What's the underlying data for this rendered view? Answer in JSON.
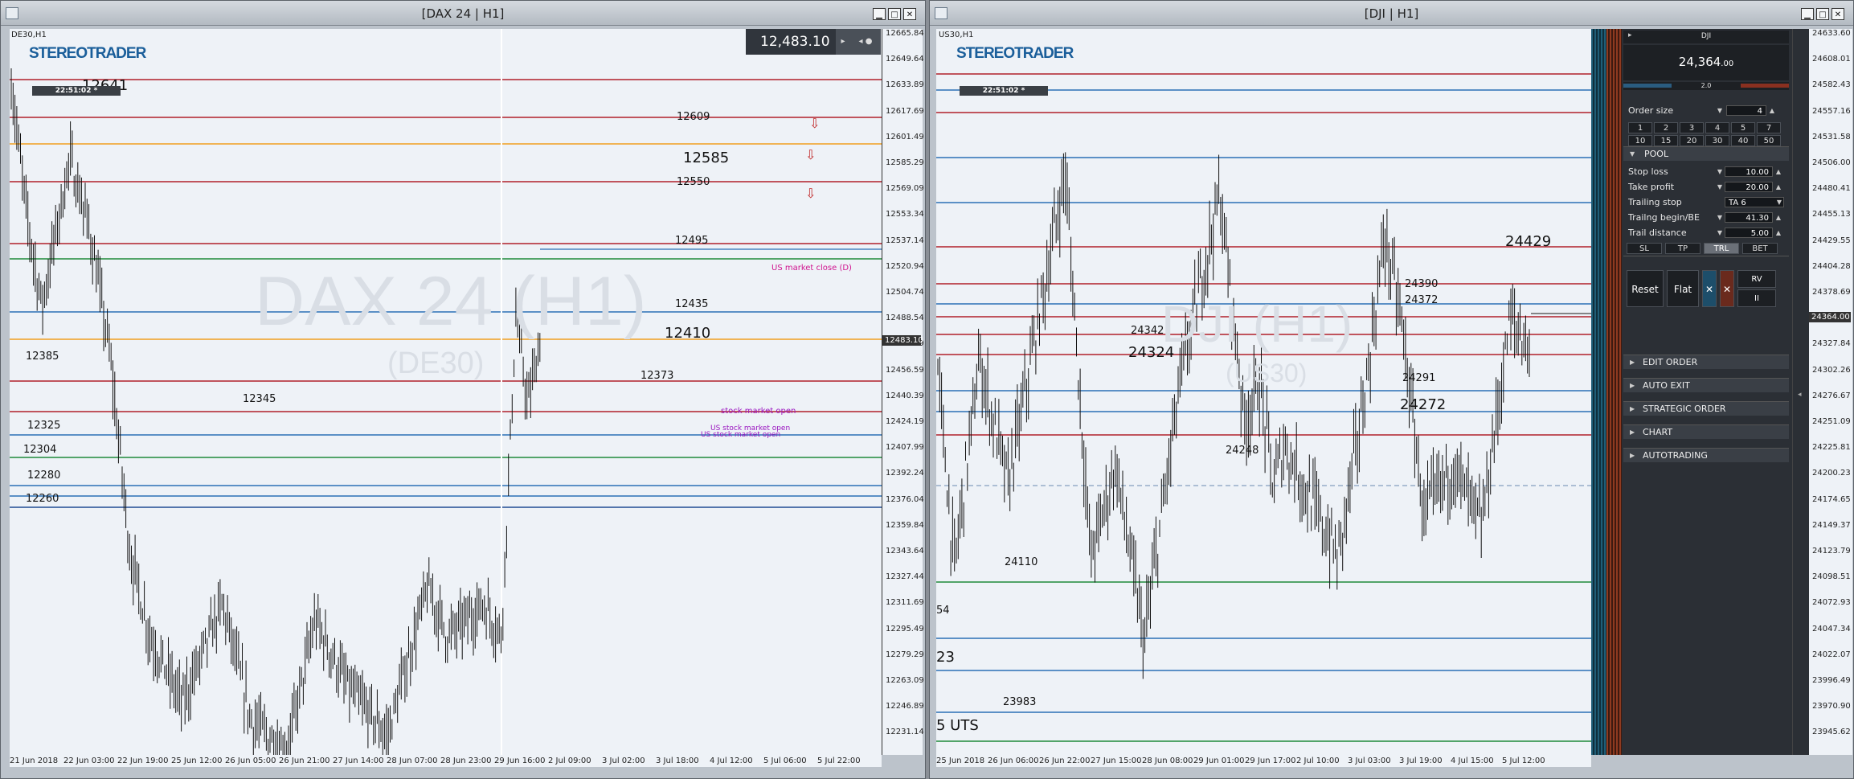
{
  "left": {
    "title": "[DAX 24 | H1]",
    "symbol_tf": "DE30,H1",
    "clock": "22:51:02 *",
    "logo": "STEREOTRADER",
    "watermark_main": "DAX 24 (H1)",
    "watermark_sub": "(DE30)",
    "quote": "12,483.10",
    "current_price_tag": "12483.10",
    "y_ticks": [
      "12665.84",
      "12649.64",
      "12633.89",
      "12617.69",
      "12601.49",
      "12585.29",
      "12569.09",
      "12553.34",
      "12537.14",
      "12520.94",
      "12504.74",
      "12488.54",
      "12472.79",
      "12456.59",
      "12440.39",
      "12424.19",
      "12407.99",
      "12392.24",
      "12376.04",
      "12359.84",
      "12343.64",
      "12327.44",
      "12311.69",
      "12295.49",
      "12279.29",
      "12263.09",
      "12246.89",
      "12231.14"
    ],
    "x_ticks": [
      "21 Jun 2018",
      "22 Jun 03:00",
      "22 Jun 19:00",
      "25 Jun 12:00",
      "26 Jun 05:00",
      "26 Jun 21:00",
      "27 Jun 14:00",
      "28 Jun 07:00",
      "28 Jun 23:00",
      "29 Jun 16:00",
      "2 Jul 09:00",
      "3 Jul 02:00",
      "3 Jul 18:00",
      "4 Jul 12:00",
      "5 Jul 06:00",
      "5 Jul 22:00"
    ],
    "levels": [
      {
        "label": "12641",
        "color": "#b0202a"
      },
      {
        "label": "12609",
        "color": "#b0202a"
      },
      {
        "label": "12585",
        "color": "#f0a020"
      },
      {
        "label": "12550",
        "color": "#b0202a"
      },
      {
        "label": "12495",
        "color": "#b0202a"
      },
      {
        "label": "",
        "color": "#1f8a3a"
      },
      {
        "label": "12435",
        "color": "#2a6fb5"
      },
      {
        "label": "12410",
        "color": "#f0a020"
      },
      {
        "label": "12385",
        "color": "none"
      },
      {
        "label": "12373",
        "color": "#b0202a"
      },
      {
        "label": "12345",
        "color": "#b0202a"
      },
      {
        "label": "12325",
        "color": "#2a6fb5"
      },
      {
        "label": "12304",
        "color": "#1f8a3a"
      },
      {
        "label": "12280",
        "color": "#2a6fb5"
      },
      {
        "label": "12260",
        "color": "#b0202a"
      }
    ],
    "annotations": {
      "market_close": "US market close (D)",
      "market_open": "stock market open",
      "open_a": "US stock market open",
      "open_b": "US stock market open"
    }
  },
  "right": {
    "title": "[DJI | H1]",
    "symbol_tf": "US30,H1",
    "clock": "22:51:02 *",
    "logo": "STEREOTRADER",
    "watermark_main": "DJI (H1)",
    "watermark_sub": "(US30)",
    "current_price_tag": "24364.00",
    "y_ticks": [
      "24633.60",
      "24608.01",
      "24582.43",
      "24557.16",
      "24531.58",
      "24506.00",
      "24480.41",
      "24455.13",
      "24429.55",
      "24404.28",
      "24378.69",
      "24353.11",
      "24327.84",
      "24302.26",
      "24276.67",
      "24251.09",
      "24225.81",
      "24200.23",
      "24174.65",
      "24149.37",
      "24123.79",
      "24098.51",
      "24072.93",
      "24047.34",
      "24022.07",
      "23996.49",
      "23970.90",
      "23945.62"
    ],
    "x_ticks": [
      "25 Jun 2018",
      "26 Jun 06:00",
      "26 Jun 22:00",
      "27 Jun 15:00",
      "28 Jun 08:00",
      "29 Jun 01:00",
      "29 Jun 17:00",
      "2 Jul 10:00",
      "3 Jul 03:00",
      "3 Jul 19:00",
      "4 Jul 15:00",
      "5 Jul 12:00"
    ],
    "levels": [
      {
        "label": "24429"
      },
      {
        "label": "24390"
      },
      {
        "label": "24372"
      },
      {
        "label": "24342"
      },
      {
        "label": "24324"
      },
      {
        "label": "24291"
      },
      {
        "label": "24272"
      },
      {
        "label": "24248"
      },
      {
        "label": "24110"
      },
      {
        "label": "54"
      },
      {
        "label": "23"
      },
      {
        "label": "23983"
      },
      {
        "label": "5 UTS"
      }
    ]
  },
  "panel": {
    "symbol": "DJI",
    "price": "24,364",
    "price_dec": ".00",
    "spread": "2.0",
    "order_size_label": "Order size",
    "order_size": "4",
    "quick_sizes": [
      "1",
      "2",
      "3",
      "4",
      "5",
      "7",
      "10",
      "15",
      "20",
      "30",
      "40",
      "50"
    ],
    "pool_label": "POOL",
    "stop_loss_label": "Stop loss",
    "stop_loss": "10.00",
    "take_profit_label": "Take profit",
    "take_profit": "20.00",
    "trailing_stop_label": "Trailing stop",
    "trailing_stop": "TA 6",
    "trailing_begin_label": "Trailng begin/BE",
    "trailing_begin": "41.30",
    "trail_distance_label": "Trail distance",
    "trail_distance": "5.00",
    "tabs": [
      "SL",
      "TP",
      "TRL",
      "BET"
    ],
    "reset": "Reset",
    "flat": "Flat",
    "x1": "✕",
    "x2": "✕",
    "rv": "RV",
    "pause": "II",
    "sections": [
      "EDIT ORDER",
      "AUTO EXIT",
      "STRATEGIC ORDER",
      "CHART",
      "AUTOTRADING"
    ]
  }
}
